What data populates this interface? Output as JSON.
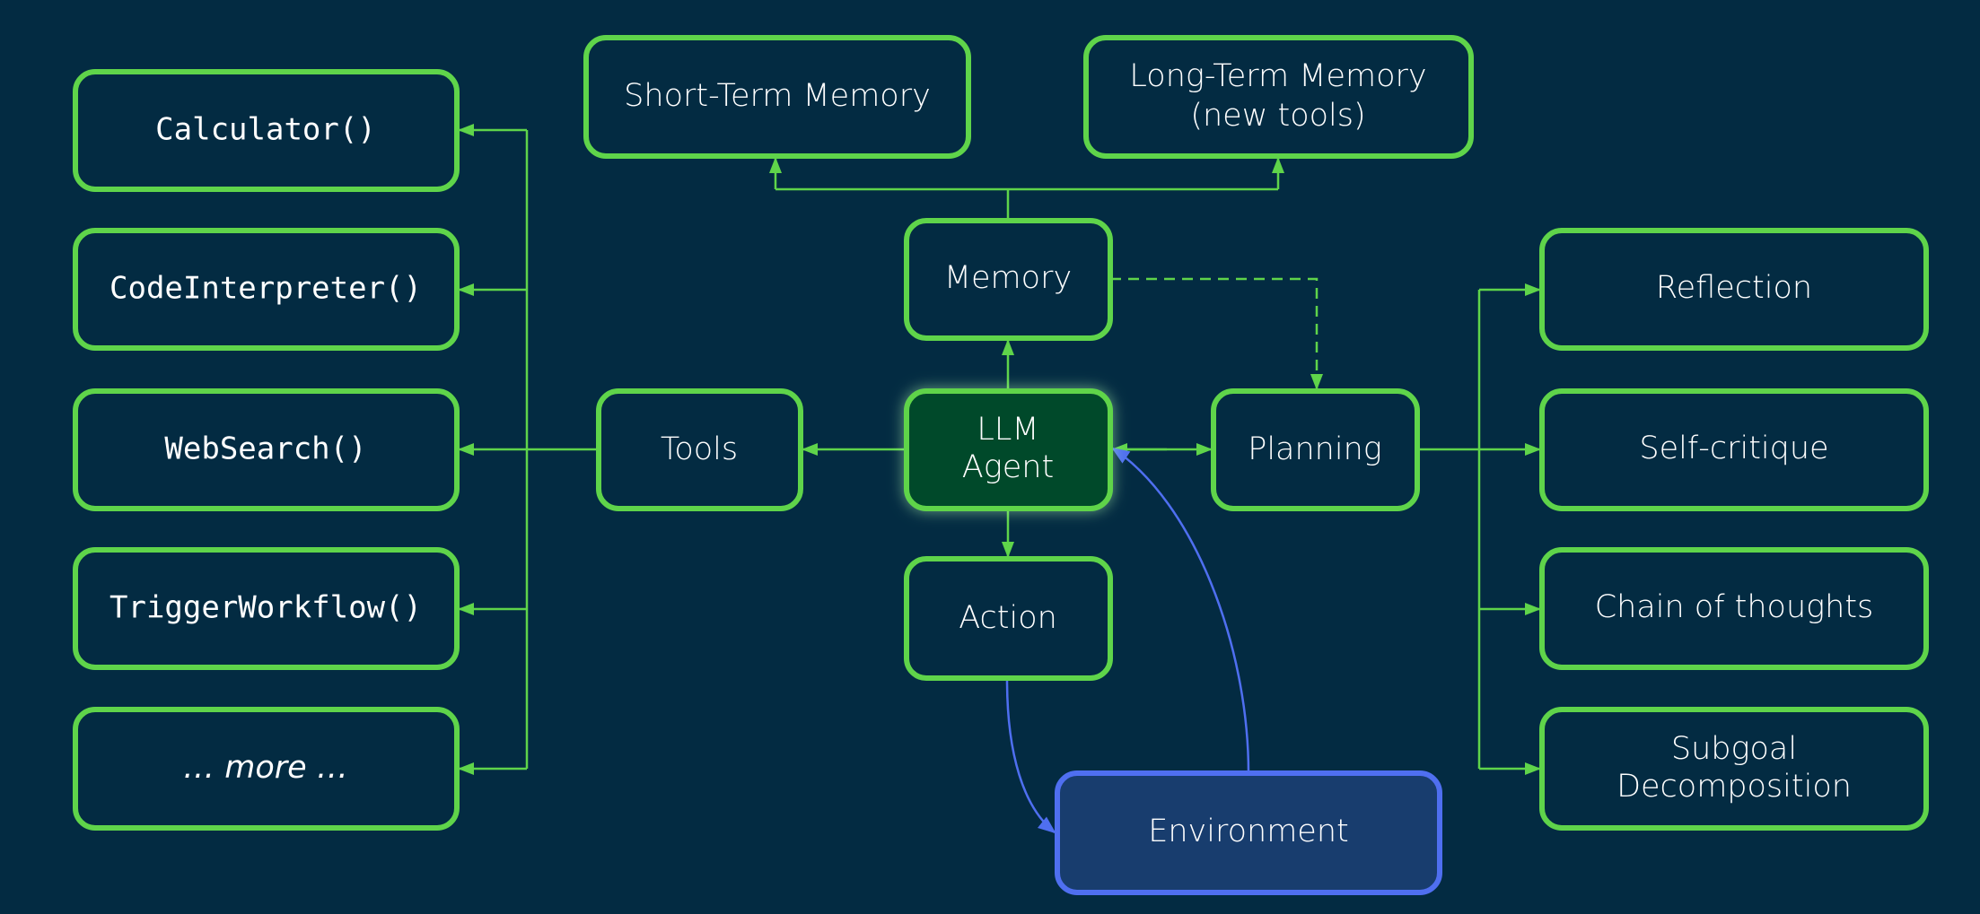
{
  "colors": {
    "background": "#032b42",
    "green": "#5fd44a",
    "agent_fill": "#034a2c",
    "environment_fill": "#183d6e",
    "blue": "#4f6ff0"
  },
  "nodes": {
    "llm_agent": [
      "LLM",
      "Agent"
    ],
    "memory": "Memory",
    "short_term_memory": "Short-Term Memory",
    "long_term_memory": [
      "Long-Term Memory",
      "(new tools)"
    ],
    "tools": "Tools",
    "planning": "Planning",
    "action": "Action",
    "environment": "Environment",
    "tool_items": [
      "Calculator()",
      "CodeInterpreter()",
      "WebSearch()",
      "TriggerWorkflow()",
      "… more …"
    ],
    "planning_items": [
      "Reflection",
      "Self-critique",
      "Chain of thoughts",
      [
        "Subgoal",
        "Decomposition"
      ]
    ]
  }
}
